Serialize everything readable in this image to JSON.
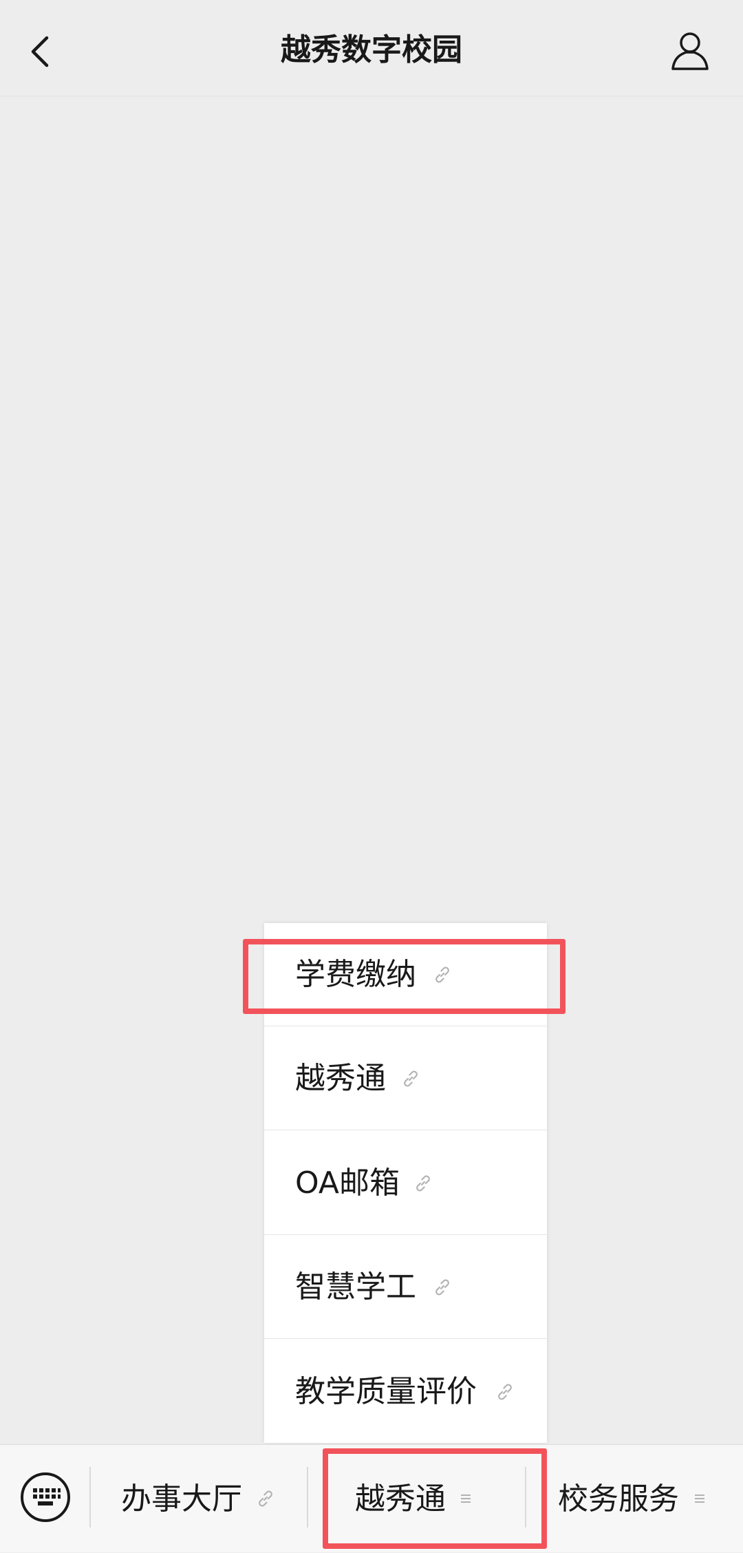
{
  "header": {
    "title": "越秀数字校园",
    "back_icon": "chevron-left-icon",
    "profile_icon": "user-icon"
  },
  "menu_popup": {
    "items": [
      {
        "label": "学费缴纳",
        "icon": "link-icon",
        "highlighted": true
      },
      {
        "label": "越秀通",
        "icon": "link-icon"
      },
      {
        "label": "OA邮箱",
        "icon": "link-icon"
      },
      {
        "label": "智慧学工",
        "icon": "link-icon"
      },
      {
        "label": "教学质量评价",
        "icon": "link-icon"
      }
    ]
  },
  "bottom_bar": {
    "keyboard_icon": "keyboard-icon",
    "tabs": [
      {
        "label": "办事大厅",
        "icon": "link-icon"
      },
      {
        "label": "越秀通",
        "icon": "menu-icon",
        "highlighted": true
      },
      {
        "label": "校务服务",
        "icon": "menu-icon"
      }
    ]
  },
  "colors": {
    "background": "#ededed",
    "highlight": "#f2535a",
    "text": "#191919",
    "icon_muted": "#b2b2b2"
  }
}
